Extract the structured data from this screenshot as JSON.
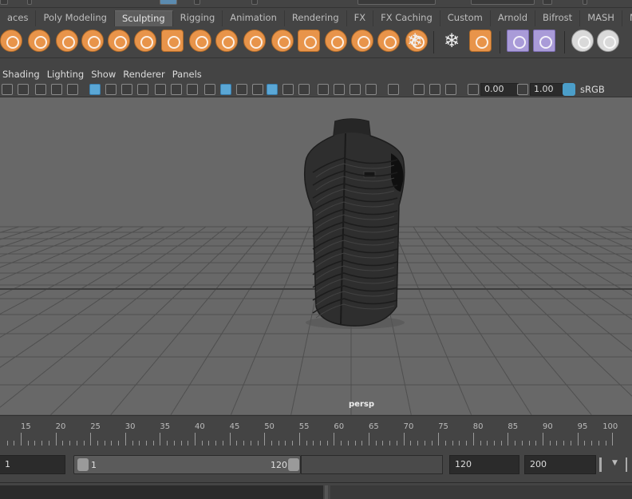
{
  "shelf_tabs": [
    {
      "label": "aces"
    },
    {
      "label": "Poly Modeling"
    },
    {
      "label": "Sculpting",
      "active": true
    },
    {
      "label": "Rigging"
    },
    {
      "label": "Animation"
    },
    {
      "label": "Rendering"
    },
    {
      "label": "FX"
    },
    {
      "label": "FX Caching"
    },
    {
      "label": "Custom"
    },
    {
      "label": "Arnold"
    },
    {
      "label": "Bifrost"
    },
    {
      "label": "MASH"
    },
    {
      "label": "M"
    }
  ],
  "panel_menu": [
    "Shading",
    "Lighting",
    "Show",
    "Renderer",
    "Panels"
  ],
  "panel_toolbar": {
    "exposure": "0.00",
    "gamma": "1.00",
    "color_space": "sRGB gamma"
  },
  "viewport": {
    "camera": "persp",
    "background": "#686868",
    "grid_color": "#4f4f4f"
  },
  "timeline": {
    "ticks": [
      "15",
      "20",
      "25",
      "30",
      "35",
      "40",
      "45",
      "50",
      "55",
      "60",
      "65",
      "70",
      "75",
      "80",
      "85",
      "90",
      "95",
      "100"
    ]
  },
  "range": {
    "current": "1",
    "start": "1",
    "end": "120",
    "anim_end": "120",
    "max": "200"
  },
  "colors": {
    "accent": "#e8944a",
    "panel": "#444444",
    "highlight": "#5aa7d6"
  }
}
